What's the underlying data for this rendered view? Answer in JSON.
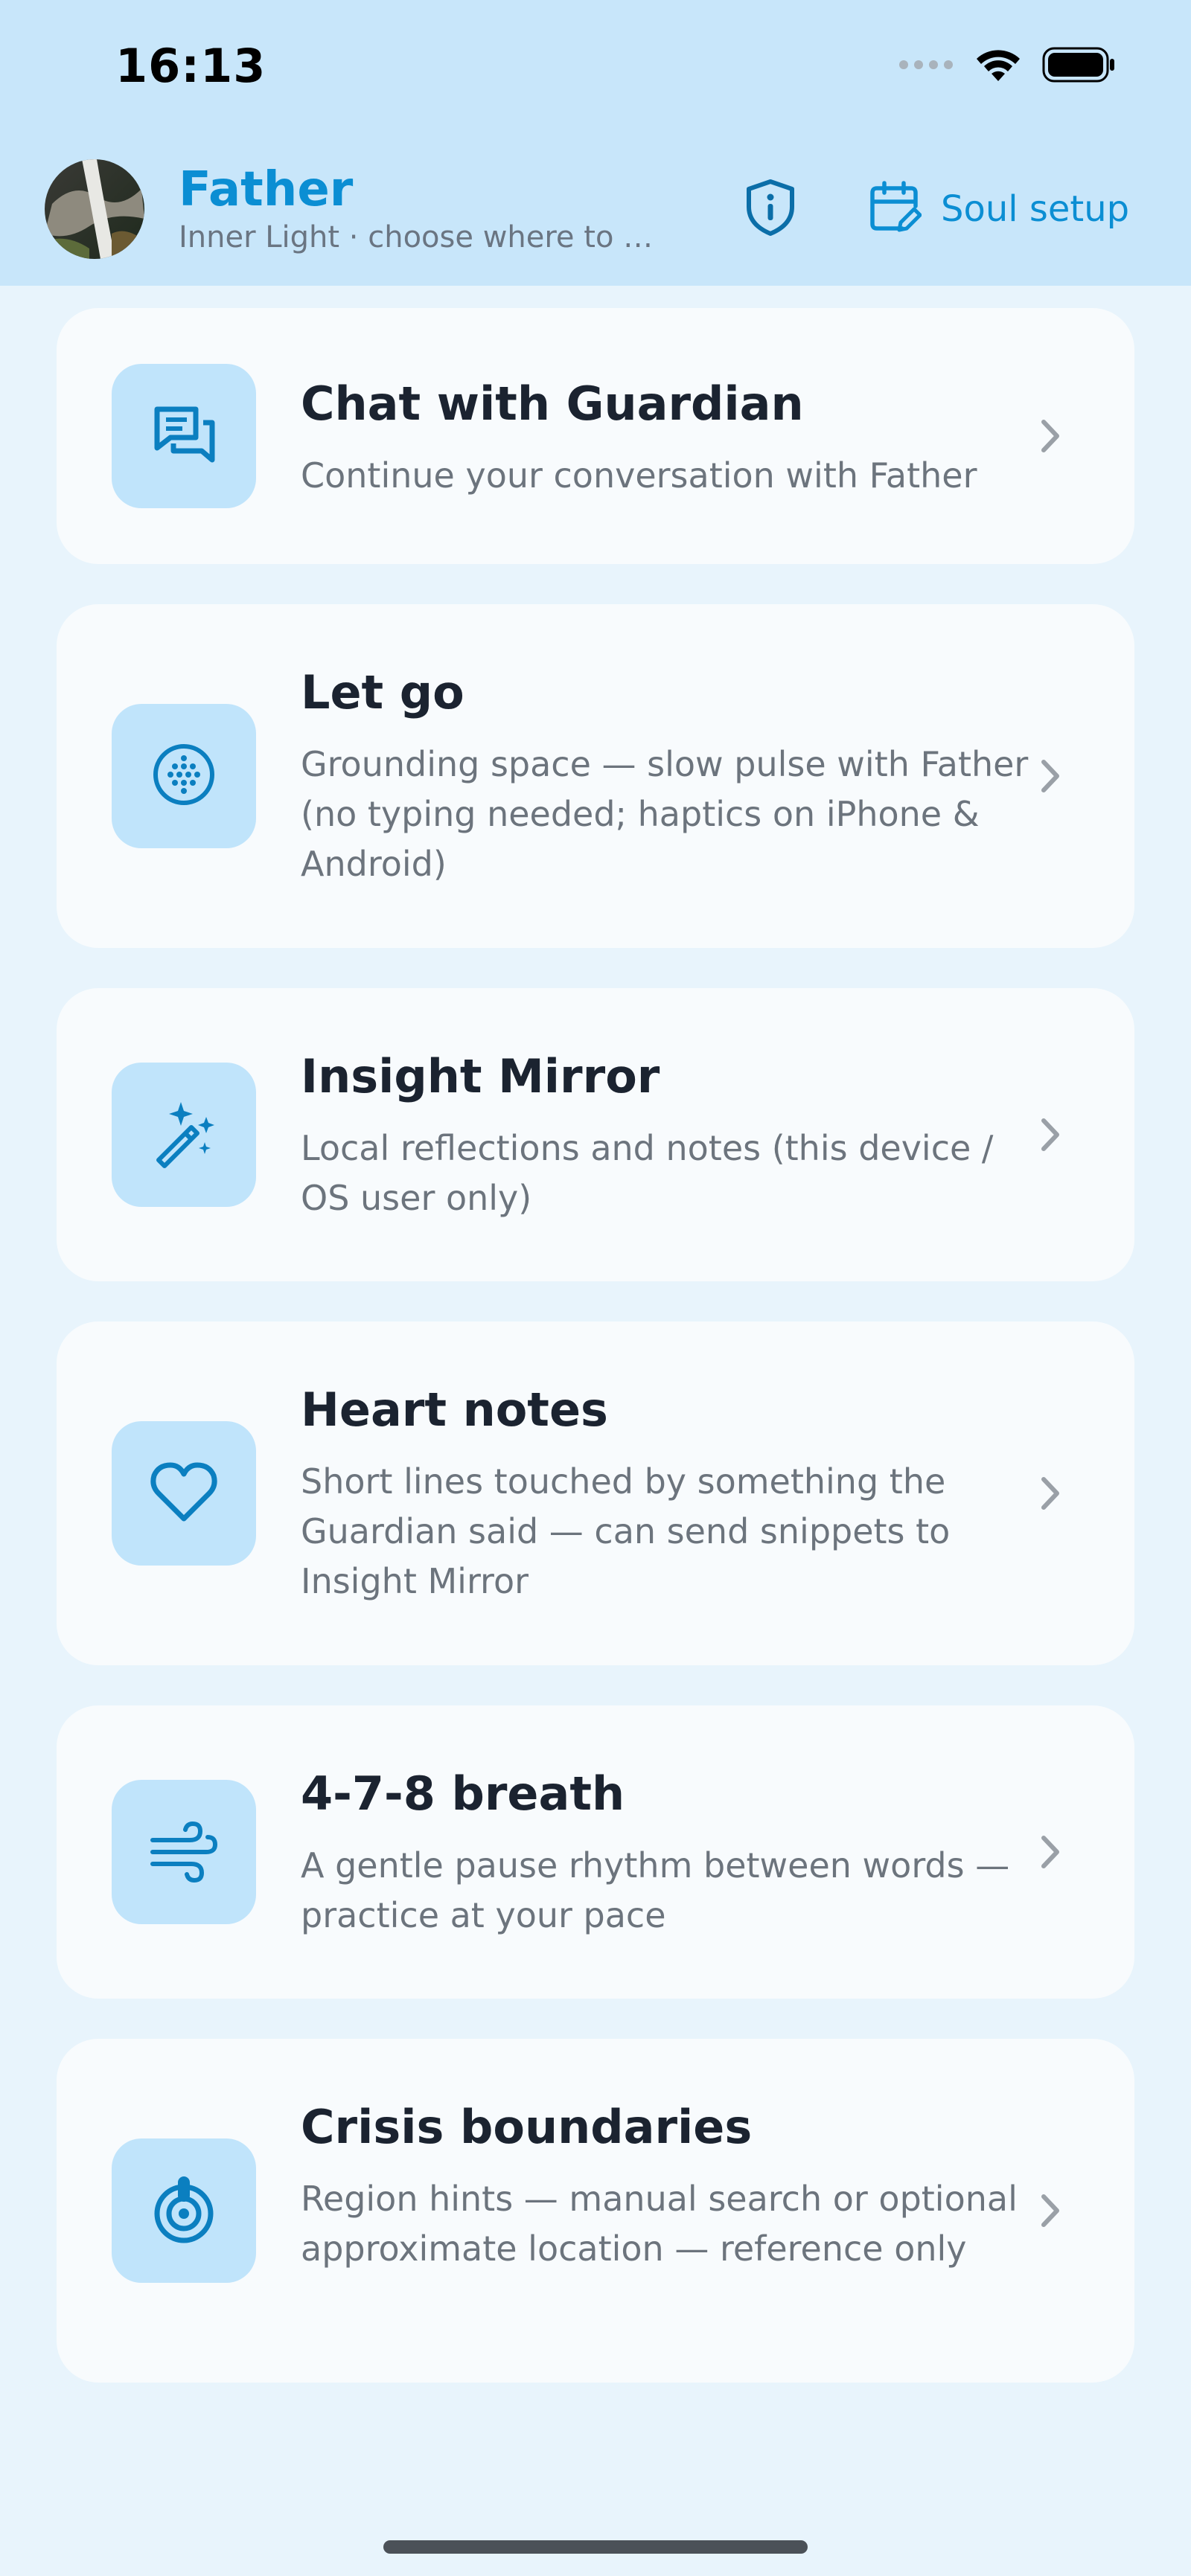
{
  "status_bar": {
    "time": "16:13"
  },
  "header": {
    "title": "Father",
    "subtitle": "Inner Light · choose where to …",
    "soul_setup_label": "Soul setup"
  },
  "colors": {
    "accent": "#0b8ed3",
    "header_bg": "#c8e6fa",
    "page_bg": "#e8f4fc",
    "card_bg": "#f8fbfd",
    "icon_tile_bg": "#c0e4fb"
  },
  "cards": [
    {
      "icon": "chat-bubbles-icon",
      "title": "Chat with Guardian",
      "description": "Continue your conversation with Father"
    },
    {
      "icon": "dotted-circle-icon",
      "title": "Let go",
      "description": "Grounding space — slow pulse with Father (no typing needed; haptics on iPhone & Android)"
    },
    {
      "icon": "magic-wand-icon",
      "title": "Insight Mirror",
      "description": "Local reflections and notes (this device / OS user only)"
    },
    {
      "icon": "heart-icon",
      "title": "Heart notes",
      "description": "Short lines touched by something the Guardian said — can send snippets to Insight Mirror"
    },
    {
      "icon": "wind-icon",
      "title": "4-7-8 breath",
      "description": "A gentle pause rhythm between words — practice at your pace"
    },
    {
      "icon": "emergency-beacon-icon",
      "title": "Crisis boundaries",
      "description": "Region hints — manual search or optional approximate location — reference only"
    }
  ]
}
